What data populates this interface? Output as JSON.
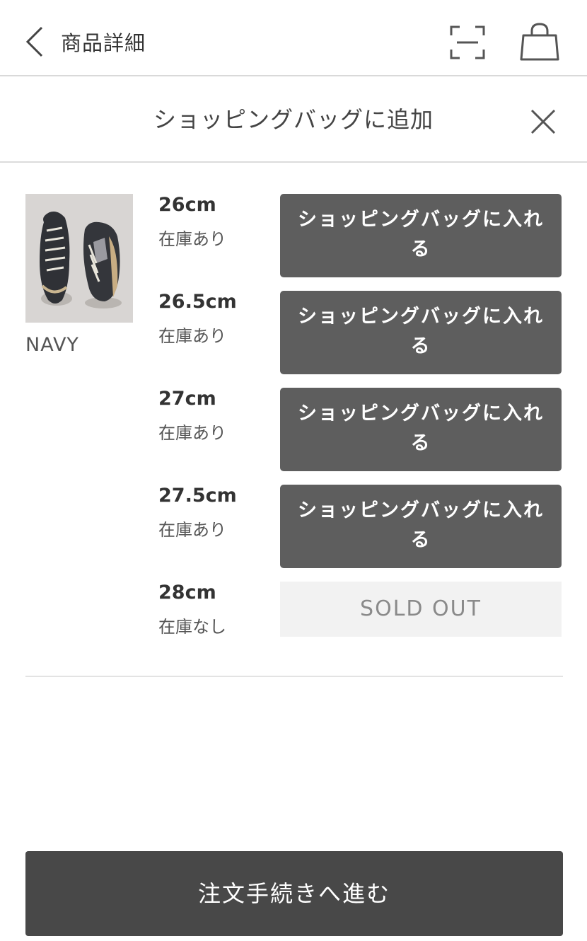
{
  "nav": {
    "title": "商品詳細",
    "back_icon": "chevron-left-icon",
    "scan_icon": "scan-icon",
    "bag_icon": "shopping-bag-icon"
  },
  "modal": {
    "title": "ショッピングバッグに追加",
    "close_icon": "close-icon"
  },
  "product": {
    "color": "NAVY"
  },
  "sizes": [
    {
      "size": "26cm",
      "stock": "在庫あり",
      "action": "ショッピングバッグに入れる"
    },
    {
      "size": "26.5cm",
      "stock": "在庫あり",
      "action": "ショッピングバッグに入れる"
    },
    {
      "size": "27cm",
      "stock": "在庫あり",
      "action": "ショッピングバッグに入れる"
    },
    {
      "size": "27.5cm",
      "stock": "在庫あり",
      "action": "ショッピングバッグに入れる"
    },
    {
      "size": "28cm",
      "stock": "在庫なし",
      "action": "SOLD OUT"
    }
  ],
  "checkout": {
    "label": "注文手続きへ進む"
  },
  "colors": {
    "button": "#5e5e5e",
    "checkout": "#484848",
    "soldout_bg": "#f2f2f2"
  }
}
